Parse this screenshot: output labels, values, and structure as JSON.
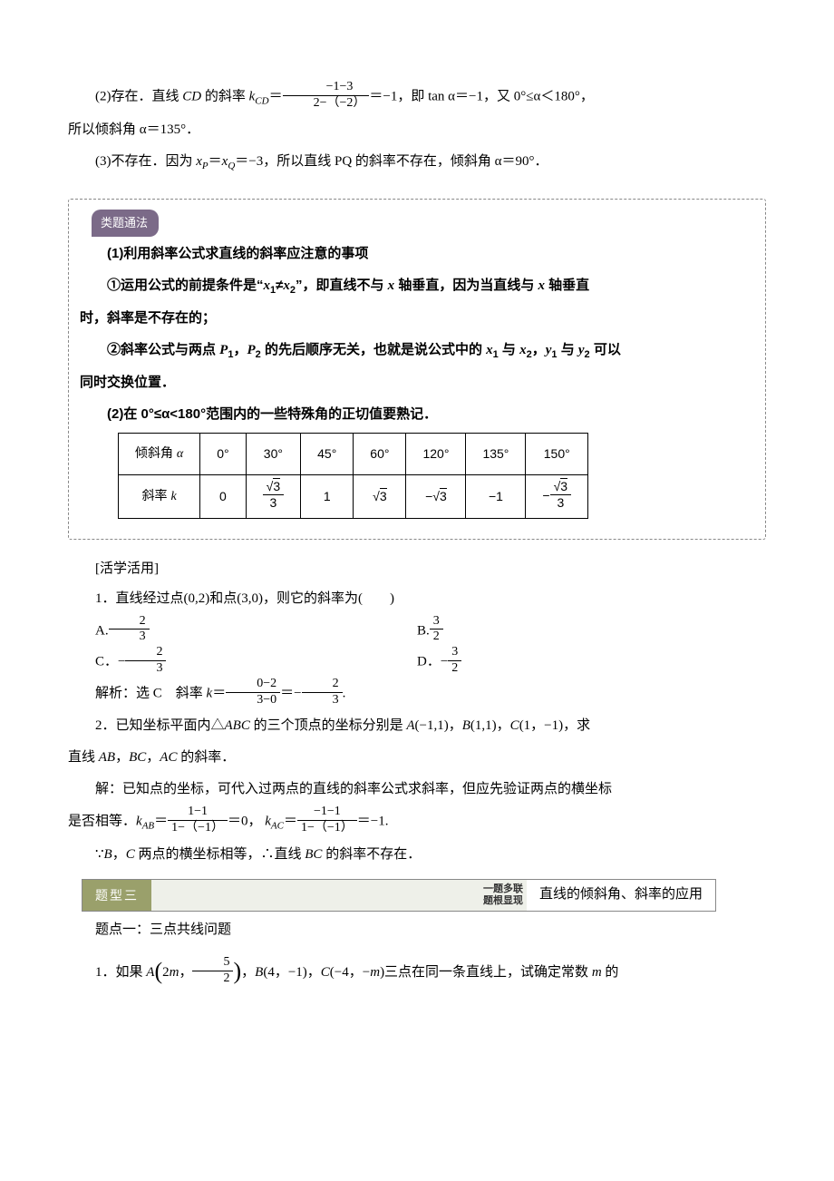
{
  "p1_prefix": "(2)存在．直线 ",
  "p1_cd": "CD",
  "p1_mid1": " 的斜率 ",
  "p1_kcd": "k",
  "p1_cd_sub": "CD",
  "p1_eq": "＝",
  "p1_num": "−1−3",
  "p1_den": "2−（−2）",
  "p1_after_frac": "＝−1，即 tan α＝−1，又 0°≤α＜180°，",
  "p2": "所以倾斜角 α＝135°．",
  "p3_prefix": "(3)不存在．因为 ",
  "p3_var1": "x",
  "p3_sub1": "P",
  "p3_eqvar": "＝",
  "p3_var2": "x",
  "p3_sub2": "Q",
  "p3_rest": "＝−3，所以直线 PQ 的斜率不存在，倾斜角 α＝90°．",
  "pill": "类题通法",
  "m1": "(1)利用斜率公式求直线的斜率应注意的事项",
  "m2a": "①运用公式的前提条件是“",
  "m2_x1": "x",
  "m2_s1": "1",
  "m2_neq": "≠",
  "m2_x2": "x",
  "m2_s2": "2",
  "m2b": "”，即直线不与 ",
  "m2_xaxis": "x",
  "m2c": " 轴垂直，因为当直线与 ",
  "m2_xaxis2": "x",
  "m2d": " 轴垂直",
  "m3": "时，斜率是不存在的；",
  "m4a": "②斜率公式与两点 ",
  "m4_p1": "P",
  "m4_p1s": "1",
  "m4_comma": "，",
  "m4_p2": "P",
  "m4_p2s": "2",
  "m4b": " 的先后顺序无关，也就是说公式中的 ",
  "m4_x1": "x",
  "m4_x1s": "1",
  "m4_and1": " 与 ",
  "m4_x2": "x",
  "m4_x2s": "2",
  "m4_comma2": "，",
  "m4_y1": "y",
  "m4_y1s": "1",
  "m4_and2": " 与 ",
  "m4_y2": "y",
  "m4_y2s": "2",
  "m4c": " 可以",
  "m5": "同时交换位置．",
  "m6": "(2)在 0°≤α<180°范围内的一些特殊角的正切值要熟记．",
  "chart_data": {
    "type": "table",
    "title": "特殊角正切值",
    "columns": [
      "倾斜角α",
      "0°",
      "30°",
      "45°",
      "60°",
      "120°",
      "135°",
      "150°"
    ],
    "rows": [
      {
        "label": "斜率 k",
        "values": [
          "0",
          "√3/3",
          "1",
          "√3",
          "−√3",
          "−1",
          "−√3/3"
        ]
      }
    ]
  },
  "th_label": "倾斜角 ",
  "th_alpha": "α",
  "th_0": "0°",
  "th_30": "30°",
  "th_45": "45°",
  "th_60": "60°",
  "th_120": "120°",
  "th_135": "135°",
  "th_150": "150°",
  "tr_label": "斜率 ",
  "tr_k": "k",
  "tr_0": "0",
  "tr_30_num": "3",
  "tr_30_den": "3",
  "tr_45": "1",
  "tr_60": "3",
  "tr_120": "3",
  "tr_135": "−1",
  "tr_150_num": "3",
  "tr_150_den": "3",
  "practice_label": "[活学活用]",
  "q1": "1．直线经过点(0,2)和点(3,0)，则它的斜率为(　　)",
  "optA": "A.",
  "optA_num": "2",
  "optA_den": "3",
  "optB": "B.",
  "optB_num": "3",
  "optB_den": "2",
  "optC": "C．−",
  "optC_num": "2",
  "optC_den": "3",
  "optD": "D．−",
  "optD_num": "3",
  "optD_den": "2",
  "sol1a": "解析：选 C　斜率 ",
  "sol1_k": "k",
  "sol1_eq": "＝",
  "sol1_num1": "0−2",
  "sol1_den1": "3−0",
  "sol1_eq2": "＝−",
  "sol1_num2": "2",
  "sol1_den2": "3",
  "sol1_end": ".",
  "q2a": "2．已知坐标平面内△",
  "q2_abc": "ABC",
  "q2b": " 的三个顶点的坐标分别是 ",
  "q2_A": "A",
  "q2_Ac": "(−1,1)，",
  "q2_B": "B",
  "q2_Bc": "(1,1)，",
  "q2_C": "C",
  "q2_Cc": "(1，−1)，求",
  "q2_line2a": "直线 ",
  "q2_AB": "AB",
  "q2_c1": "，",
  "q2_BC": "BC",
  "q2_c2": "，",
  "q2_AC": "AC",
  "q2_line2b": " 的斜率．",
  "sol2a": "解：已知点的坐标，可代入过两点的直线的斜率公式求斜率，但应先验证两点的横坐标",
  "sol2b_pre": "是否相等．",
  "sol2_kab": "k",
  "sol2_kab_sub": "AB",
  "sol2_eq1": "＝",
  "sol2_num1": "1−1",
  "sol2_den1": "1−（−1）",
  "sol2_r1": "＝0，",
  "sol2_kac": "k",
  "sol2_kac_sub": "AC",
  "sol2_eq2": "＝",
  "sol2_num2": "−1−1",
  "sol2_den2": "1−（−1）",
  "sol2_r2": "＝−1.",
  "sol2c_pre": "∵",
  "sol2c_B": "B",
  "sol2c_c": "，",
  "sol2c_C": "C",
  "sol2c_mid": " 两点的横坐标相等，∴直线 ",
  "sol2c_BC": "BC",
  "sol2c_end": " 的斜率不存在．",
  "type3_label": "题型三",
  "type3_mid1": "一题多联",
  "type3_mid2": "题根显现",
  "type3_right": "直线的倾斜角、斜率的应用",
  "topic1": "题点一：三点共线问题",
  "q3a": "1．如果 ",
  "q3_A": "A",
  "q3_Aarg1": "2",
  "q3_Aarg1_m": "m",
  "q3_Acomma": "，",
  "q3_Anum": "5",
  "q3_Aden": "2",
  "q3_mid": "，",
  "q3_B": "B",
  "q3_Bc": "(4，−1)，",
  "q3_C": "C",
  "q3_Cc": "(−4，−",
  "q3_Cm": "m",
  "q3_Cend": ")三点在同一条直线上，试确定常数 ",
  "q3_m": "m",
  "q3_end": " 的"
}
